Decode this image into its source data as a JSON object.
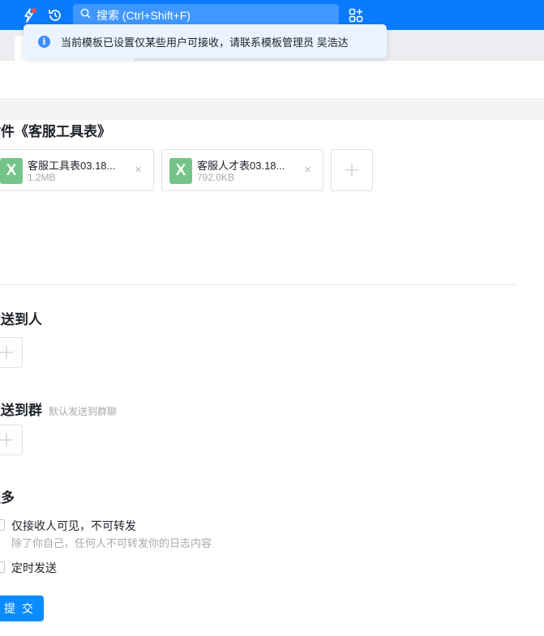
{
  "topbar": {
    "search_placeholder": "搜索 (Ctrl+Shift+F)",
    "accent": "#0a7aff",
    "icons": [
      "lightning-icon",
      "history-icon",
      "search-icon",
      "app-grid-icon"
    ]
  },
  "notice": {
    "text": "当前模板已设置仅某些用户可接收，请联系模板管理员 吴浩达",
    "icon": "info-icon"
  },
  "attachments": {
    "title": "附件《客服工具表》",
    "files": [
      {
        "name": "客服工具表03.18...",
        "size": "1.2MB",
        "type_label": "X"
      },
      {
        "name": "客服人才表03.18...",
        "size": "792.0KB",
        "type_label": "X"
      }
    ],
    "close_glyph": "×"
  },
  "send_to_person": {
    "title": "发送到人"
  },
  "send_to_group": {
    "title": "发送到群",
    "hint": "默认发送到群聊"
  },
  "more": {
    "title": "更多",
    "options": [
      {
        "label": "仅接收人可见，不可转发",
        "desc": "除了你自己，任何人不可转发你的日志内容",
        "checked": false
      },
      {
        "label": "定时发送",
        "checked": false
      }
    ]
  },
  "submit": {
    "label": "提 交"
  }
}
